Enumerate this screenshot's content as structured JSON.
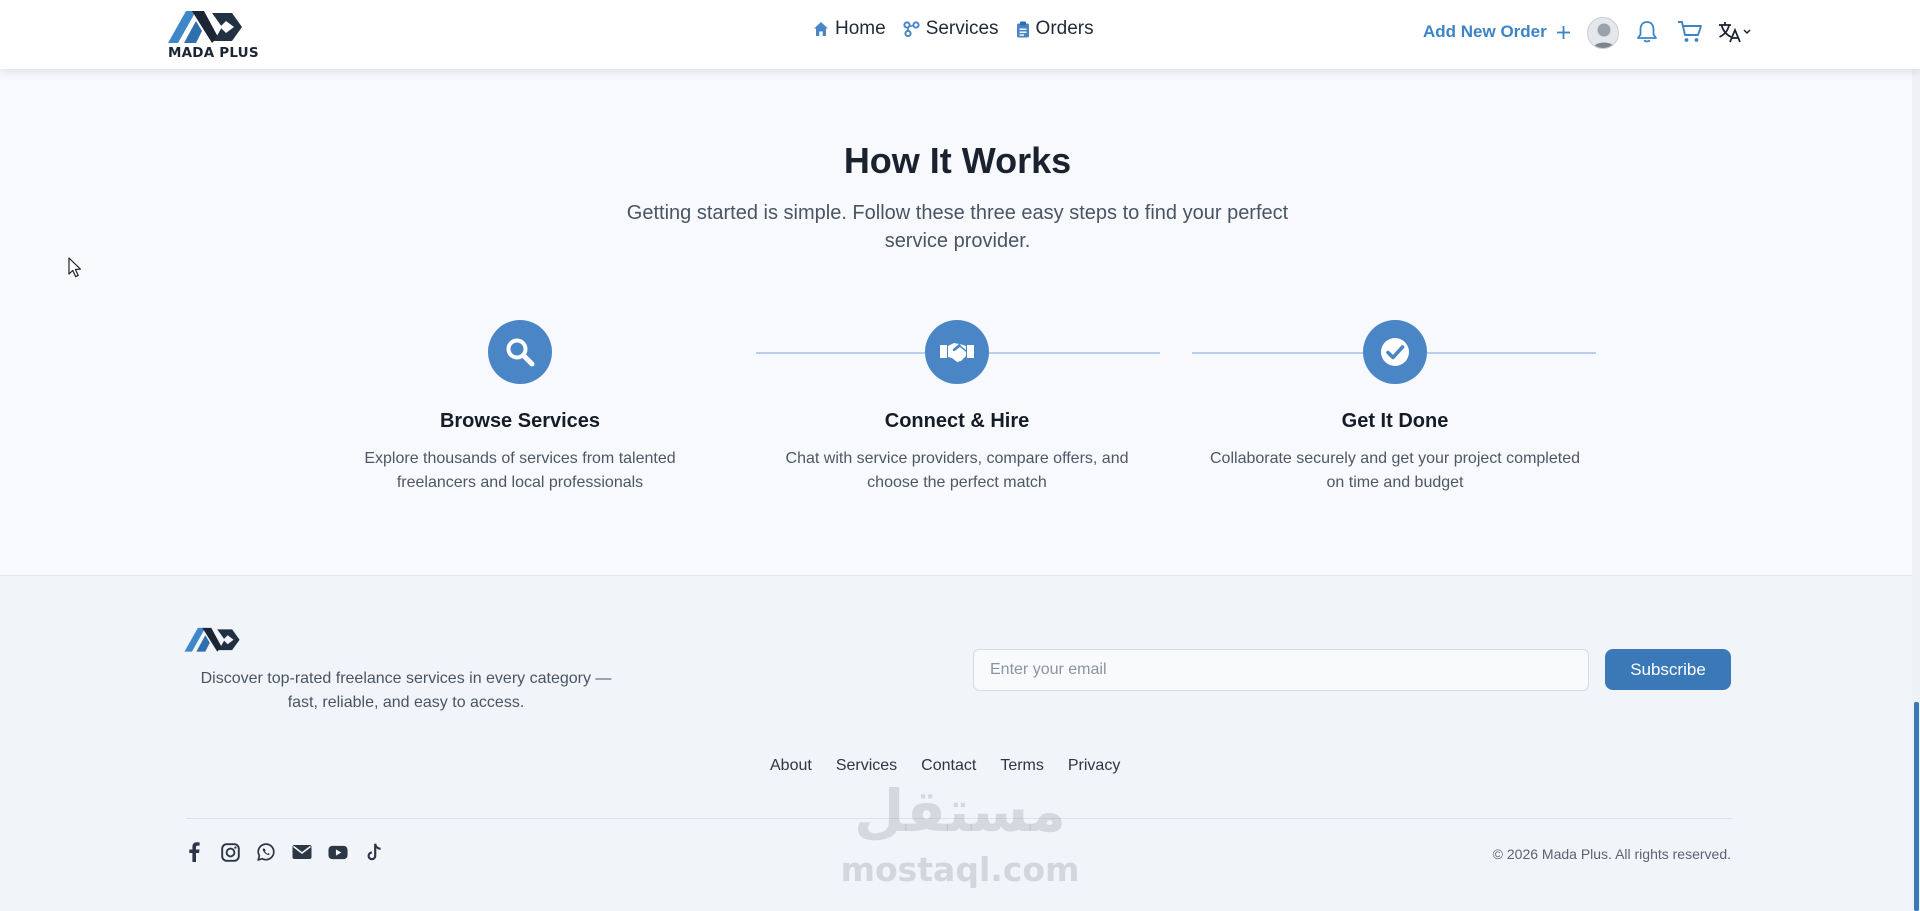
{
  "header": {
    "logo_text": "MADA PLUS",
    "nav": [
      {
        "label": "Home",
        "icon": "home-icon"
      },
      {
        "label": "Services",
        "icon": "services-icon"
      },
      {
        "label": "Orders",
        "icon": "clipboard-icon"
      }
    ],
    "add_order_label": "Add New Order",
    "icons": [
      "plus-icon",
      "avatar",
      "bell-icon",
      "cart-icon",
      "translate-icon",
      "chevron-down-icon"
    ]
  },
  "how_it_works": {
    "title": "How It Works",
    "subtitle": "Getting started is simple. Follow these three easy steps to find your perfect service provider.",
    "steps": [
      {
        "icon": "search-icon",
        "title": "Browse Services",
        "description": "Explore thousands of services from talented freelancers and local professionals"
      },
      {
        "icon": "handshake-icon",
        "title": "Connect & Hire",
        "description": "Chat with service providers, compare offers, and choose the perfect match"
      },
      {
        "icon": "check-circle-icon",
        "title": "Get It Done",
        "description": "Collaborate securely and get your project completed on time and budget"
      }
    ]
  },
  "footer": {
    "description": "Discover top-rated freelance services in every category — fast, reliable, and easy to access.",
    "email_placeholder": "Enter your email",
    "email_value": "",
    "subscribe_label": "Subscribe",
    "links": [
      "About",
      "Services",
      "Contact",
      "Terms",
      "Privacy"
    ],
    "socials": [
      "facebook-icon",
      "instagram-icon",
      "whatsapp-icon",
      "envelope-icon",
      "youtube-icon",
      "tiktok-icon"
    ],
    "copyright": "© 2026 Mada Plus. All rights reserved."
  },
  "watermark": {
    "arabic": "مستقل",
    "latin": "mostaql.com"
  },
  "colors": {
    "accent": "#4a86c5",
    "button": "#3a78b8",
    "link_blue": "#3d84c6",
    "text_dark": "#1a2230"
  }
}
